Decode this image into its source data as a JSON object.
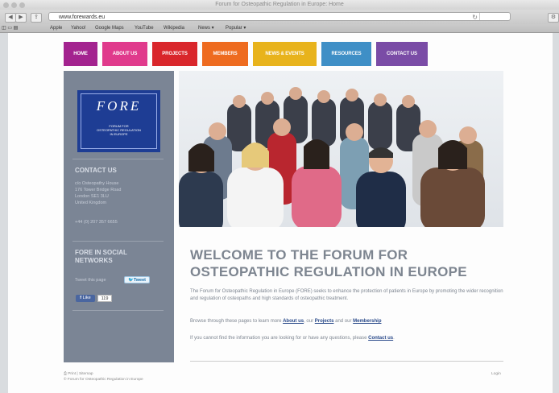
{
  "browser": {
    "window_title": "Forum for Osteopathic Regulation in Europe: Home",
    "url": "www.forewards.eu",
    "bookmarks": [
      "Apple",
      "Yahoo!",
      "Google Maps",
      "YouTube",
      "Wikipedia",
      "News ▾",
      "Popular ▾"
    ]
  },
  "nav": {
    "items": [
      {
        "label": "HOME",
        "color": "#a3238f"
      },
      {
        "label": "ABOUT US",
        "color": "#e03a8c"
      },
      {
        "label": "PROJECTS",
        "color": "#d9262b"
      },
      {
        "label": "MEMBERS",
        "color": "#ee6b1f"
      },
      {
        "label": "NEWS & EVENTS",
        "color": "#e8b31c"
      },
      {
        "label": "RESOURCES",
        "color": "#3f8fc6"
      },
      {
        "label": "CONTACT US",
        "color": "#7a4ca6"
      }
    ]
  },
  "logo": {
    "title": "FORE",
    "subtitle_lines": [
      "FORUM FOR",
      "OSTEOPATHIC REGULATION",
      "IN EUROPE"
    ]
  },
  "sidebar": {
    "contact_heading": "CONTACT US",
    "address_lines": [
      "c/o Osteopathy House",
      "176 Tower Bridge Road",
      "London SE1 3LU",
      "United Kingdom"
    ],
    "phone": "+44 (0) 207 357 6655",
    "social_heading_lines": [
      "FORE IN SOCIAL",
      "NETWORKS"
    ],
    "tweet_label": "Tweet this page",
    "tweet_button": "Tweet",
    "like_button": "Like",
    "like_count": "119"
  },
  "main": {
    "heading_lines": [
      "WELCOME TO THE FORUM FOR",
      "OSTEOPATHIC REGULATION IN EUROPE"
    ],
    "intro": "The Forum for Osteopathic Regulation in Europe (FORE) seeks to enhance the protection of patients in Europe by promoting the wider recognition and regulation of osteopaths and high standards of osteopathic treatment.",
    "browse_prefix": "Browse through these pages to learn more ",
    "browse_link1": "About us",
    "browse_sep1": ", our ",
    "browse_link2": "Projects",
    "browse_sep2": " and our ",
    "browse_link3": "Membership",
    "questions_prefix": "If you cannot find the information you are looking for or have any questions, please ",
    "questions_link": "Contact us",
    "questions_suffix": "."
  },
  "footer": {
    "links": "Print | Sitemap",
    "copyright": "© Forum for Osteopathic Regulation in Europe",
    "login": "Login"
  }
}
